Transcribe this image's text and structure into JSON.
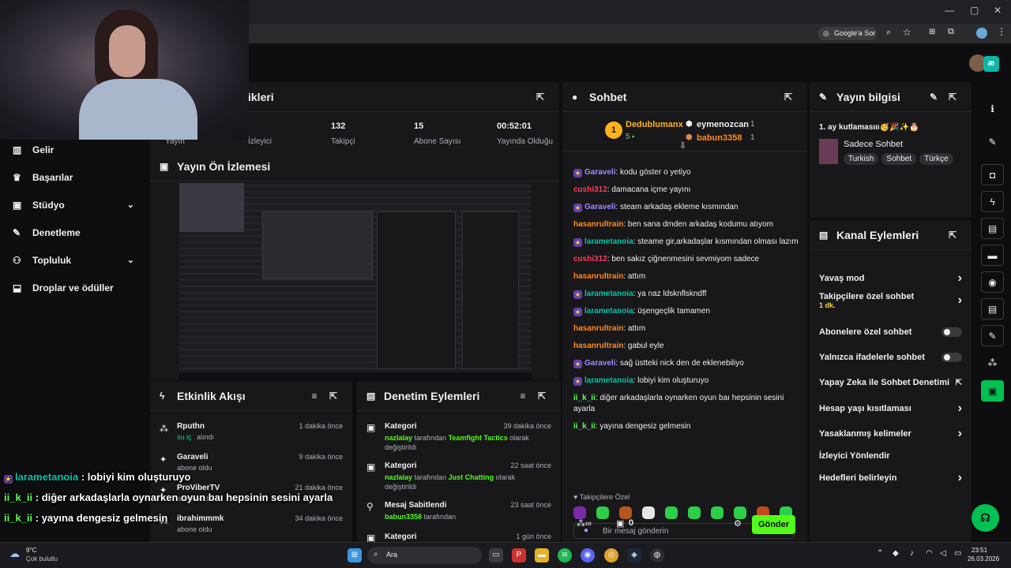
{
  "browser": {
    "google_lens": "Google'a Sor"
  },
  "stats": {
    "title_partial": "ikleri",
    "items": [
      {
        "value": "",
        "label": "Yayın"
      },
      {
        "value": "",
        "label": "İzleyici"
      },
      {
        "value": "132",
        "label": "Takipçi"
      },
      {
        "value": "15",
        "label": "Abone Sayısı"
      },
      {
        "value": "00:52:01",
        "label": "Yayında Olduğu"
      }
    ]
  },
  "sidebar": {
    "items": [
      {
        "label": "Gelir",
        "icon": "bar-chart-icon",
        "chevron": false
      },
      {
        "label": "Başarılar",
        "icon": "trophy-icon",
        "chevron": false
      },
      {
        "label": "Stüdyo",
        "icon": "studio-icon",
        "chevron": true
      },
      {
        "label": "Denetleme",
        "icon": "wrench-icon",
        "chevron": false
      },
      {
        "label": "Topluluk",
        "icon": "community-icon",
        "chevron": true
      },
      {
        "label": "Droplar ve ödüller",
        "icon": "drops-icon",
        "chevron": false
      }
    ]
  },
  "preview": {
    "title": "Yayın Ön İzlemesi"
  },
  "activity": {
    "title": "Etkinlik Akışı",
    "items": [
      {
        "name": "Rputhn",
        "sub": "su iç",
        "sub2": "alındı",
        "time": "1 dakika önce",
        "sub_color": "#00db84"
      },
      {
        "name": "Garaveli",
        "sub": "abone oldu",
        "sub2": "",
        "time": "9 dakika önce",
        "sub_color": "#adadb8"
      },
      {
        "name": "ProViberTV",
        "sub": "abone oldu",
        "sub2": "",
        "time": "21 dakika önce",
        "sub_color": "#adadb8"
      },
      {
        "name": "ibrahimmmk",
        "sub": "abone oldu",
        "sub2": "",
        "time": "34 dakika önce",
        "sub_color": "#adadb8"
      }
    ]
  },
  "mod": {
    "title": "Denetim Eylemleri",
    "items": [
      {
        "name": "Kategori",
        "time": "39 dakika önce",
        "user": "nazlalay",
        "mid": " tarafından ",
        "target": "Teamfight Tactics",
        "end": " olarak değiştirildi"
      },
      {
        "name": "Kategori",
        "time": "22 saat önce",
        "user": "nazlalay",
        "mid": " tarafından ",
        "target": "Just Chatting",
        "end": " olarak değiştirildi"
      },
      {
        "name": "Mesaj Sabitlendi",
        "time": "23 saat önce",
        "user": "babun3358",
        "mid": " tarafından",
        "target": "",
        "end": ""
      },
      {
        "name": "Kategori",
        "time": "1 gün önce",
        "user": "",
        "mid": "",
        "target": "",
        "end": ""
      }
    ]
  },
  "chat": {
    "title": "Sohbet",
    "leaders": {
      "first": {
        "rank": "1",
        "name": "Dedublumanx",
        "count": "5"
      },
      "second": {
        "name": "eymenozcan",
        "count": "1"
      },
      "third": {
        "name": "babun3358",
        "count": "1"
      }
    },
    "messages": [
      {
        "user": "Garaveli",
        "color": "#9e8cff",
        "badge": true,
        "text": ": kodu göster o yetiyo"
      },
      {
        "user": "cushi312",
        "color": "#ff3d5a",
        "badge": false,
        "text": ": damacana içme yayını"
      },
      {
        "user": "Garaveli",
        "color": "#9e8cff",
        "badge": true,
        "text": ": steam arkadaş ekleme kısmından"
      },
      {
        "user": "hasanrultrain",
        "color": "#ff8a1f",
        "badge": false,
        "text": ": ben sana dmden arkadaş kodumu atıyom"
      },
      {
        "user": "larametanoia",
        "color": "#00c6a8",
        "badge": true,
        "text": ": steame gir,arkadaşlar kısmından olması lazım"
      },
      {
        "user": "cushi312",
        "color": "#ff3d5a",
        "badge": false,
        "text": ": ben sakız çiğnenmesini sevmiyom sadece"
      },
      {
        "user": "hasanrultrain",
        "color": "#ff8a1f",
        "badge": false,
        "text": ": attım"
      },
      {
        "user": "larametanoia",
        "color": "#00c6a8",
        "badge": true,
        "text": ": ya naz ldsknflskndff"
      },
      {
        "user": "larametanoia",
        "color": "#00c6a8",
        "badge": true,
        "text": ": üşengeçlik tamamen"
      },
      {
        "user": "hasanrultrain",
        "color": "#ff8a1f",
        "badge": false,
        "text": ": attım"
      },
      {
        "user": "hasanrultrain",
        "color": "#ff8a1f",
        "badge": false,
        "text": ": gabul eyle"
      },
      {
        "user": "Garaveli",
        "color": "#9e8cff",
        "badge": true,
        "text": ": sağ üstteki nick den de eklenebiliyo"
      },
      {
        "user": "larametanoia",
        "color": "#00c6a8",
        "badge": true,
        "text": ": lobiyi kim oluşturuyo"
      },
      {
        "user": "ii_k_ii",
        "color": "#5cff5c",
        "badge": false,
        "text": ": diğer arkadaşlarla oynarken oyun baı hepsinin sesini ayarla"
      },
      {
        "user": "ii_k_ii",
        "color": "#5cff5c",
        "badge": false,
        "text": ": yayına dengesiz gelmesin"
      }
    ],
    "followers_only": "Takipçilere Özel",
    "input_placeholder": "Bir mesaj gönderin",
    "points": "0",
    "send_label": "Gönder"
  },
  "stream_info": {
    "title": "Yayın bilgisi",
    "stream_title": "1. ay kutlamasııı🥳🎉✨🎂",
    "category": "Sadece Sohbet",
    "tags": [
      "Turkish",
      "Sohbet",
      "Türkçe"
    ]
  },
  "channel_actions": {
    "title": "Kanal Eylemleri",
    "items": [
      {
        "label": "Yavaş mod",
        "sub": "",
        "control": "chevron"
      },
      {
        "label": "Takipçilere özel sohbet",
        "sub": "1 dk.",
        "control": "chevron"
      },
      {
        "label": "Abonelere özel sohbet",
        "sub": "",
        "control": "toggle"
      },
      {
        "label": "Yalnızca ifadelerle sohbet",
        "sub": "",
        "control": "toggle"
      },
      {
        "label": "Yapay Zeka ile Sohbet Denetimi",
        "sub": "",
        "control": "external"
      },
      {
        "label": "Hesap yaşı kısıtlaması",
        "sub": "",
        "control": "chevron"
      },
      {
        "label": "Yasaklanmış kelimeler",
        "sub": "",
        "control": "chevron"
      },
      {
        "label": "İzleyici Yönlendir",
        "sub": "",
        "control": "none"
      },
      {
        "label": "Hedefleri belirleyin",
        "sub": "",
        "control": "chevron"
      }
    ]
  },
  "overlay_chat": [
    {
      "user": "larametanoia",
      "color": "#00c6a8",
      "text": " : lobiyi kim oluşturuyo"
    },
    {
      "user": "ii_k_ii",
      "color": "#5cff5c",
      "text": " : diğer arkadaşlarla oynarken oyun baı hepsinin sesini ayarla"
    },
    {
      "user": "ii_k_ii",
      "color": "#5cff5c",
      "text": " : yayına dengesiz gelmesin"
    }
  ],
  "taskbar": {
    "weather_temp": "9°C",
    "weather_desc": "Çok bulutlu",
    "search": "Ara",
    "time": "23:51",
    "date": "26.03.2026"
  },
  "colors": {
    "accent": "#53fc18",
    "panel": "#18181b",
    "bg": "#0e0e10"
  }
}
